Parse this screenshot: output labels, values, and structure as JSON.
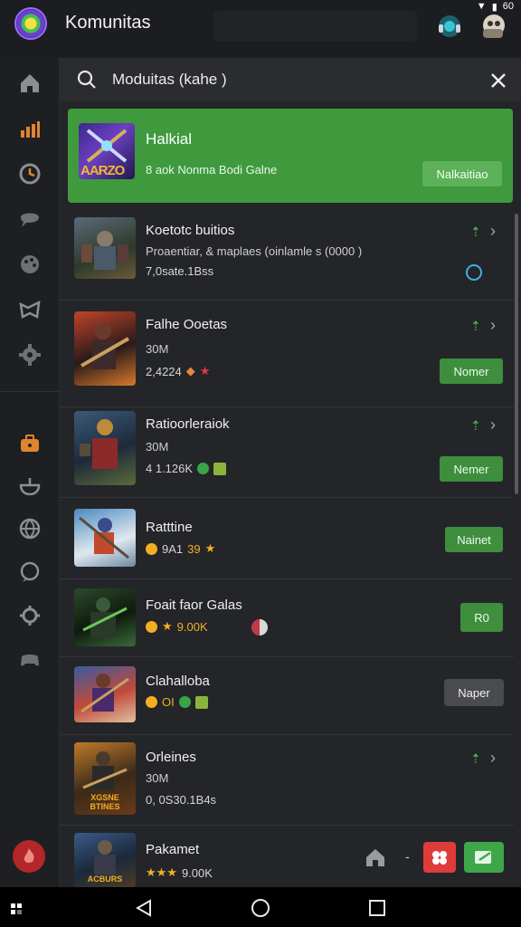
{
  "app": {
    "title": "Komunitas"
  },
  "search": {
    "query": "Moduitas (kahe )"
  },
  "featured": {
    "title": "Halkial",
    "subtitle": "8 aok Nonma Bodi Galne",
    "button": "Nalkaitiao",
    "thumb_text": "AARZO"
  },
  "rows": [
    {
      "title": "Koetotc buitios",
      "line2": "Proaentiar, & maplaes (oinlamle s (0000 )",
      "line3": "7,0sate.1Bss"
    },
    {
      "title": "Falhe Ooetas",
      "line2": "30M",
      "line3": "2,4224",
      "button": "Nomer"
    },
    {
      "title": "Ratioorleraiok",
      "line2": "30M",
      "line3": "4 1.126K",
      "button": "Nemer"
    },
    {
      "title": "Ratttine",
      "line3a": "9A1",
      "line3b": "39",
      "button": "Nainet"
    },
    {
      "title": "Foait faor Galas",
      "line3": "9.00K",
      "button": "R0"
    },
    {
      "title": "Clahalloba",
      "line3": "OI",
      "button": "Naper"
    },
    {
      "title": "Orleines",
      "line2": "30M",
      "line3": "0, 0S30.1B4s",
      "thumb_text": "XGSNE BTINES"
    },
    {
      "title": "Pakamet",
      "line3": "9.00K",
      "thumb_text": "ACBURS"
    }
  ],
  "colors": {
    "accent_green": "#3f9a3e",
    "button_green": "#3e8e3e",
    "fab_red": "#e03b3b",
    "background": "#1c1d20"
  },
  "icons": [
    "home-icon",
    "chart-icon",
    "clock-icon",
    "chat-icon",
    "palette-icon",
    "controller-icon",
    "gear-icon",
    "briefcase-icon",
    "bowl-icon",
    "globe-icon",
    "chat-bubble-icon",
    "settings-icon",
    "gamepad-icon",
    "fire-icon"
  ],
  "status": {
    "battery": "60"
  }
}
